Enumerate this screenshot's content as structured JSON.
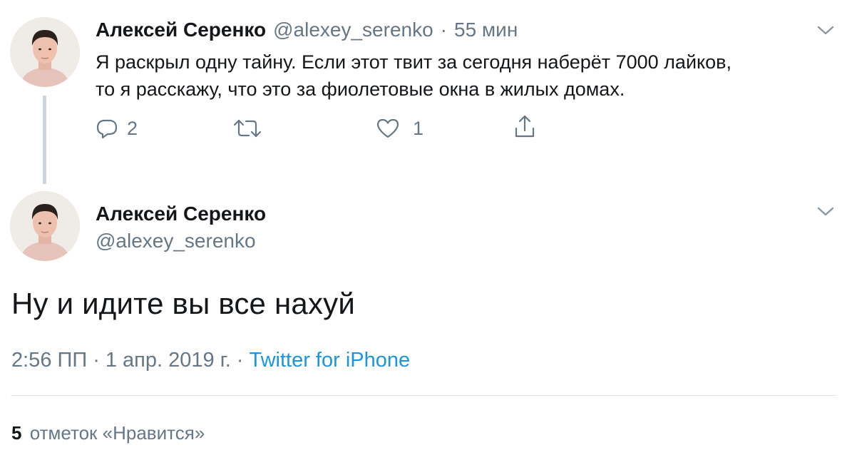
{
  "parent_tweet": {
    "author_name": "Алексей Серенко",
    "handle": "@alexey_serenko",
    "separator": "·",
    "time_ago": "55 мин",
    "text_line1": "Я раскрыл одну тайну. Если этот твит за сегодня наберёт 7000 лайков,",
    "text_line2": "то я расскажу, что это за фиолетовые окна в жилых домах.",
    "reply_count": "2",
    "retweet_count": "",
    "like_count": "1",
    "icons": {
      "reply": "reply-bubble-icon",
      "retweet": "retweet-icon",
      "like": "heart-icon",
      "share": "share-icon",
      "menu": "chevron-down-icon"
    }
  },
  "main_tweet": {
    "author_name": "Алексей Серенко",
    "handle": "@alexey_serenko",
    "text": "Ну и идите вы все нахуй",
    "time": "2:56 ПП",
    "dot1": "·",
    "date": "1 апр. 2019 г.",
    "dot2": "·",
    "source": "Twitter for iPhone"
  },
  "stats": {
    "likes_number": "5",
    "likes_label": "отметок «Нравится»"
  },
  "colors": {
    "text_primary": "#14171a",
    "text_secondary": "#657786",
    "link": "#1b95e0",
    "divider": "#e1e8ed",
    "thread_line": "#cdd5dc"
  }
}
